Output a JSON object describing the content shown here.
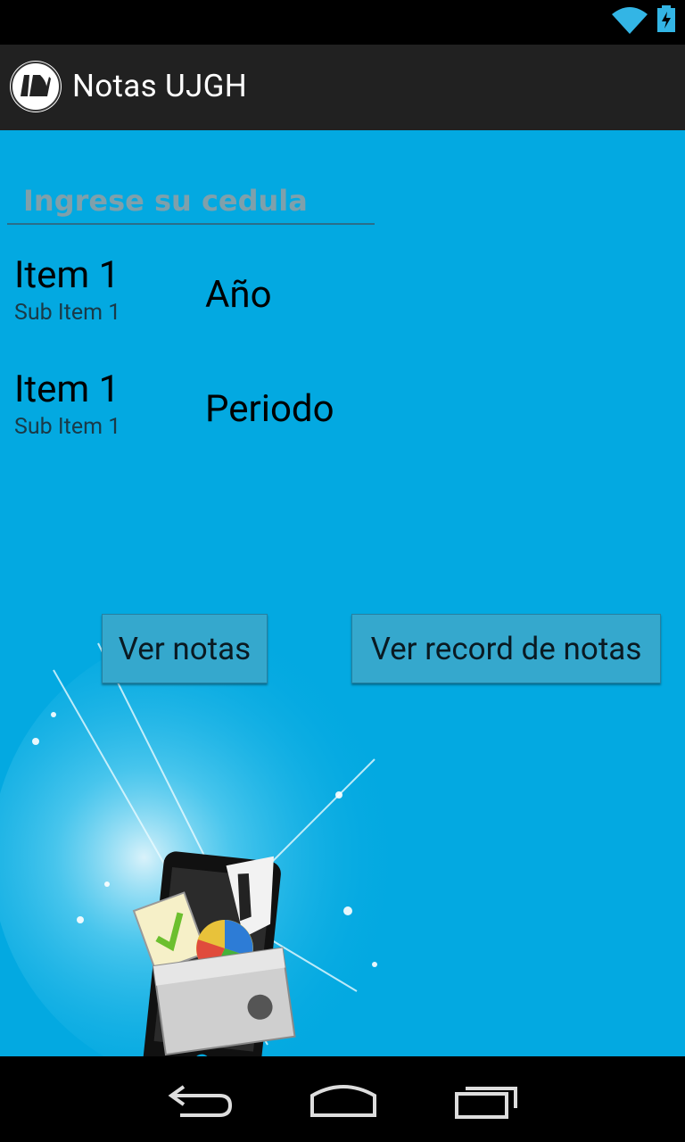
{
  "status_bar": {
    "wifi_icon": "wifi-icon",
    "battery_icon": "battery-charging-icon"
  },
  "action_bar": {
    "title": "Notas UJGH",
    "logo_icon": "ujgh-logo-icon"
  },
  "form": {
    "cedula_placeholder": "Ingrese su cedula",
    "cedula_value": ""
  },
  "spinners": [
    {
      "title": "Item 1",
      "subtitle": "Sub Item 1",
      "label": "Año"
    },
    {
      "title": "Item 1",
      "subtitle": "Sub Item 1",
      "label": "Periodo"
    }
  ],
  "buttons": {
    "ver_notas": "Ver notas",
    "ver_record": "Ver record de notas"
  },
  "hero": {
    "image_icon": "phone-with-documents-illustration"
  },
  "nav": {
    "back_icon": "back-icon",
    "home_icon": "home-icon",
    "recents_icon": "recents-icon"
  },
  "colors": {
    "background": "#03a9e1",
    "action_bar": "#212121",
    "button": "#35a8cd"
  }
}
